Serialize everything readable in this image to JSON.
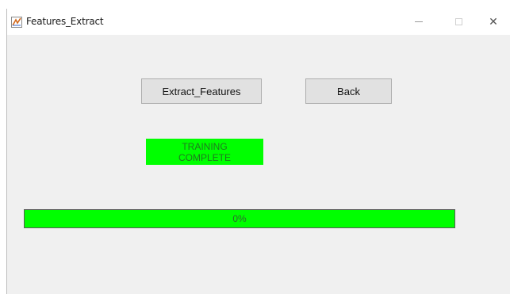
{
  "window": {
    "title": "Features_Extract",
    "icon": "matlab-figure-icon"
  },
  "titlebar_controls": {
    "minimize_icon": "minimize-icon",
    "maximize_icon": "maximize-icon",
    "close_icon": "close-icon",
    "close_glyph": "✕"
  },
  "buttons": {
    "extract_label": "Extract_Features",
    "back_label": "Back"
  },
  "status": {
    "line1": "TRAINING",
    "line2": "COMPLETE",
    "color": "#00ff00"
  },
  "progress": {
    "label": "0%",
    "value": 1.0,
    "color": "#00ff00"
  }
}
